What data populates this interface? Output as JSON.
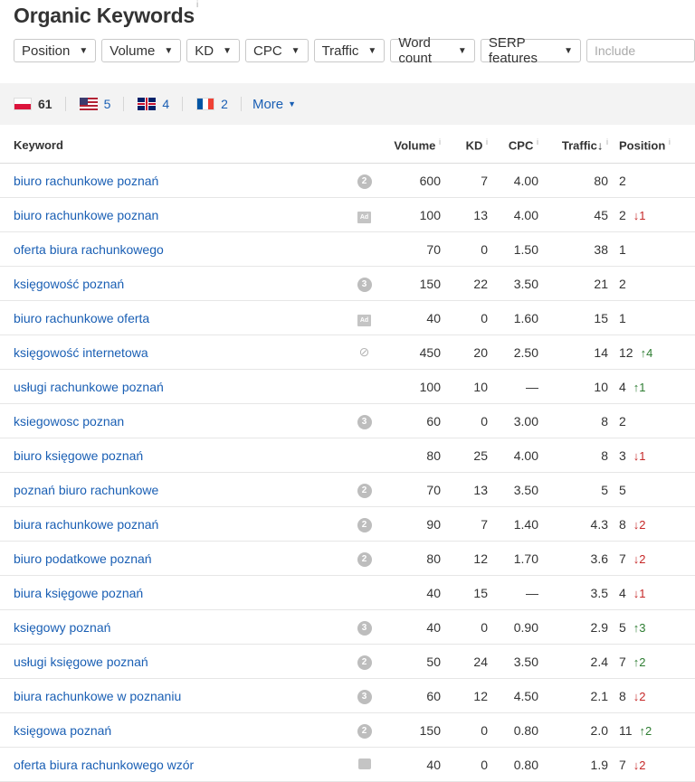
{
  "page": {
    "title": "Organic Keywords",
    "title_info": "i"
  },
  "filters": [
    {
      "label": "Position"
    },
    {
      "label": "Volume"
    },
    {
      "label": "KD"
    },
    {
      "label": "CPC"
    },
    {
      "label": "Traffic"
    },
    {
      "label": "Word count"
    },
    {
      "label": "SERP features"
    }
  ],
  "include_placeholder": "Include",
  "countries": [
    {
      "flag": "pl",
      "count": "61",
      "active": true
    },
    {
      "flag": "us",
      "count": "5"
    },
    {
      "flag": "gb",
      "count": "4"
    },
    {
      "flag": "fr",
      "count": "2"
    }
  ],
  "more_label": "More",
  "table": {
    "headers": {
      "keyword": "Keyword",
      "volume": "Volume",
      "kd": "KD",
      "cpc": "CPC",
      "traffic": "Traffic",
      "position": "Position",
      "info": "i",
      "sort_arrow": "↓"
    },
    "rows": [
      {
        "keyword": "biuro rachunkowe poznań",
        "serp": "2",
        "serp_type": "circle",
        "volume": "600",
        "kd": "7",
        "cpc": "4.00",
        "traffic": "80",
        "position": "2",
        "change": "",
        "dir": ""
      },
      {
        "keyword": "biuro rachunkowe poznan",
        "serp": "Ad",
        "serp_type": "ad",
        "volume": "100",
        "kd": "13",
        "cpc": "4.00",
        "traffic": "45",
        "position": "2",
        "change": "1",
        "dir": "down"
      },
      {
        "keyword": "oferta biura rachunkowego",
        "serp": "",
        "serp_type": "",
        "volume": "70",
        "kd": "0",
        "cpc": "1.50",
        "traffic": "38",
        "position": "1",
        "change": "",
        "dir": ""
      },
      {
        "keyword": "księgowość poznań",
        "serp": "3",
        "serp_type": "circle",
        "volume": "150",
        "kd": "22",
        "cpc": "3.50",
        "traffic": "21",
        "position": "2",
        "change": "",
        "dir": ""
      },
      {
        "keyword": "biuro rachunkowe oferta",
        "serp": "Ad",
        "serp_type": "ad",
        "volume": "40",
        "kd": "0",
        "cpc": "1.60",
        "traffic": "15",
        "position": "1",
        "change": "",
        "dir": ""
      },
      {
        "keyword": "księgowość internetowa",
        "serp": "",
        "serp_type": "link",
        "volume": "450",
        "kd": "20",
        "cpc": "2.50",
        "traffic": "14",
        "position": "12",
        "change": "4",
        "dir": "up"
      },
      {
        "keyword": "usługi rachunkowe poznań",
        "serp": "",
        "serp_type": "",
        "volume": "100",
        "kd": "10",
        "cpc": "—",
        "traffic": "10",
        "position": "4",
        "change": "1",
        "dir": "up"
      },
      {
        "keyword": "ksiegowosc poznan",
        "serp": "3",
        "serp_type": "circle",
        "volume": "60",
        "kd": "0",
        "cpc": "3.00",
        "traffic": "8",
        "position": "2",
        "change": "",
        "dir": ""
      },
      {
        "keyword": "biuro księgowe poznań",
        "serp": "",
        "serp_type": "",
        "volume": "80",
        "kd": "25",
        "cpc": "4.00",
        "traffic": "8",
        "position": "3",
        "change": "1",
        "dir": "down"
      },
      {
        "keyword": "poznań biuro rachunkowe",
        "serp": "2",
        "serp_type": "circle",
        "volume": "70",
        "kd": "13",
        "cpc": "3.50",
        "traffic": "5",
        "position": "5",
        "change": "",
        "dir": ""
      },
      {
        "keyword": "biura rachunkowe poznań",
        "serp": "2",
        "serp_type": "circle",
        "volume": "90",
        "kd": "7",
        "cpc": "1.40",
        "traffic": "4.3",
        "position": "8",
        "change": "2",
        "dir": "down"
      },
      {
        "keyword": "biuro podatkowe poznań",
        "serp": "2",
        "serp_type": "circle",
        "volume": "80",
        "kd": "12",
        "cpc": "1.70",
        "traffic": "3.6",
        "position": "7",
        "change": "2",
        "dir": "down"
      },
      {
        "keyword": "biura księgowe poznań",
        "serp": "",
        "serp_type": "",
        "volume": "40",
        "kd": "15",
        "cpc": "—",
        "traffic": "3.5",
        "position": "4",
        "change": "1",
        "dir": "down"
      },
      {
        "keyword": "księgowy poznań",
        "serp": "3",
        "serp_type": "circle",
        "volume": "40",
        "kd": "0",
        "cpc": "0.90",
        "traffic": "2.9",
        "position": "5",
        "change": "3",
        "dir": "up"
      },
      {
        "keyword": "usługi księgowe poznań",
        "serp": "2",
        "serp_type": "circle",
        "volume": "50",
        "kd": "24",
        "cpc": "3.50",
        "traffic": "2.4",
        "position": "7",
        "change": "2",
        "dir": "up"
      },
      {
        "keyword": "biura rachunkowe w poznaniu",
        "serp": "3",
        "serp_type": "circle",
        "volume": "60",
        "kd": "12",
        "cpc": "4.50",
        "traffic": "2.1",
        "position": "8",
        "change": "2",
        "dir": "down"
      },
      {
        "keyword": "księgowa poznań",
        "serp": "2",
        "serp_type": "circle",
        "volume": "150",
        "kd": "0",
        "cpc": "0.80",
        "traffic": "2.0",
        "position": "11",
        "change": "2",
        "dir": "up"
      },
      {
        "keyword": "oferta biura rachunkowego wzór",
        "serp": "",
        "serp_type": "image",
        "volume": "40",
        "kd": "0",
        "cpc": "0.80",
        "traffic": "1.9",
        "position": "7",
        "change": "2",
        "dir": "down"
      }
    ]
  }
}
